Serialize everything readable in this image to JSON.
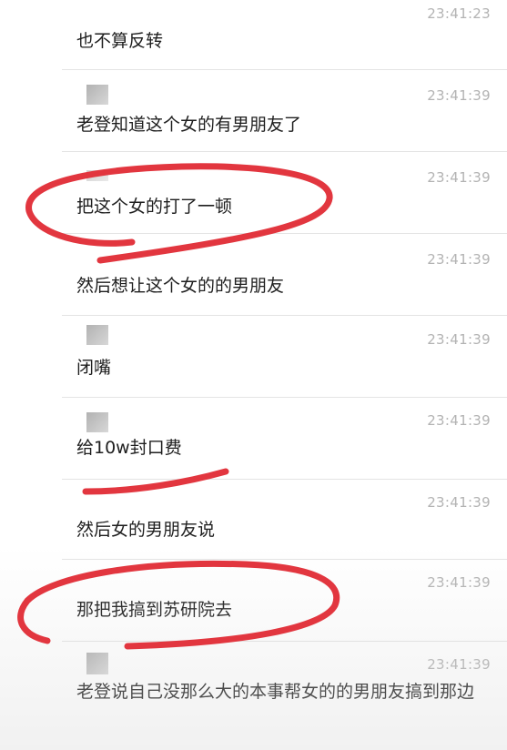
{
  "messages": [
    {
      "time": "23:41:23",
      "text": "也不算反转",
      "avatar": false
    },
    {
      "time": "23:41:39",
      "text": "老登知道这个女的有男朋友了",
      "avatar": true
    },
    {
      "time": "23:41:39",
      "text": "把这个女的打了一顿",
      "avatar": true
    },
    {
      "time": "23:41:39",
      "text": "然后想让这个女的的男朋友",
      "avatar": false
    },
    {
      "time": "23:41:39",
      "text": "闭嘴",
      "avatar": true
    },
    {
      "time": "23:41:39",
      "text": "给10w封口费",
      "avatar": true
    },
    {
      "time": "23:41:39",
      "text": "然后女的男朋友说",
      "avatar": false
    },
    {
      "time": "23:41:39",
      "text": "那把我搞到苏研院去",
      "avatar": false
    },
    {
      "time": "23:41:39",
      "text": "老登说自己没那么大的本事帮女的的男朋友搞到那边",
      "avatar": true
    }
  ],
  "colors": {
    "annotation_red": "#e2363f",
    "time_gray": "#b3b3b3",
    "text": "#1e1e1e"
  }
}
